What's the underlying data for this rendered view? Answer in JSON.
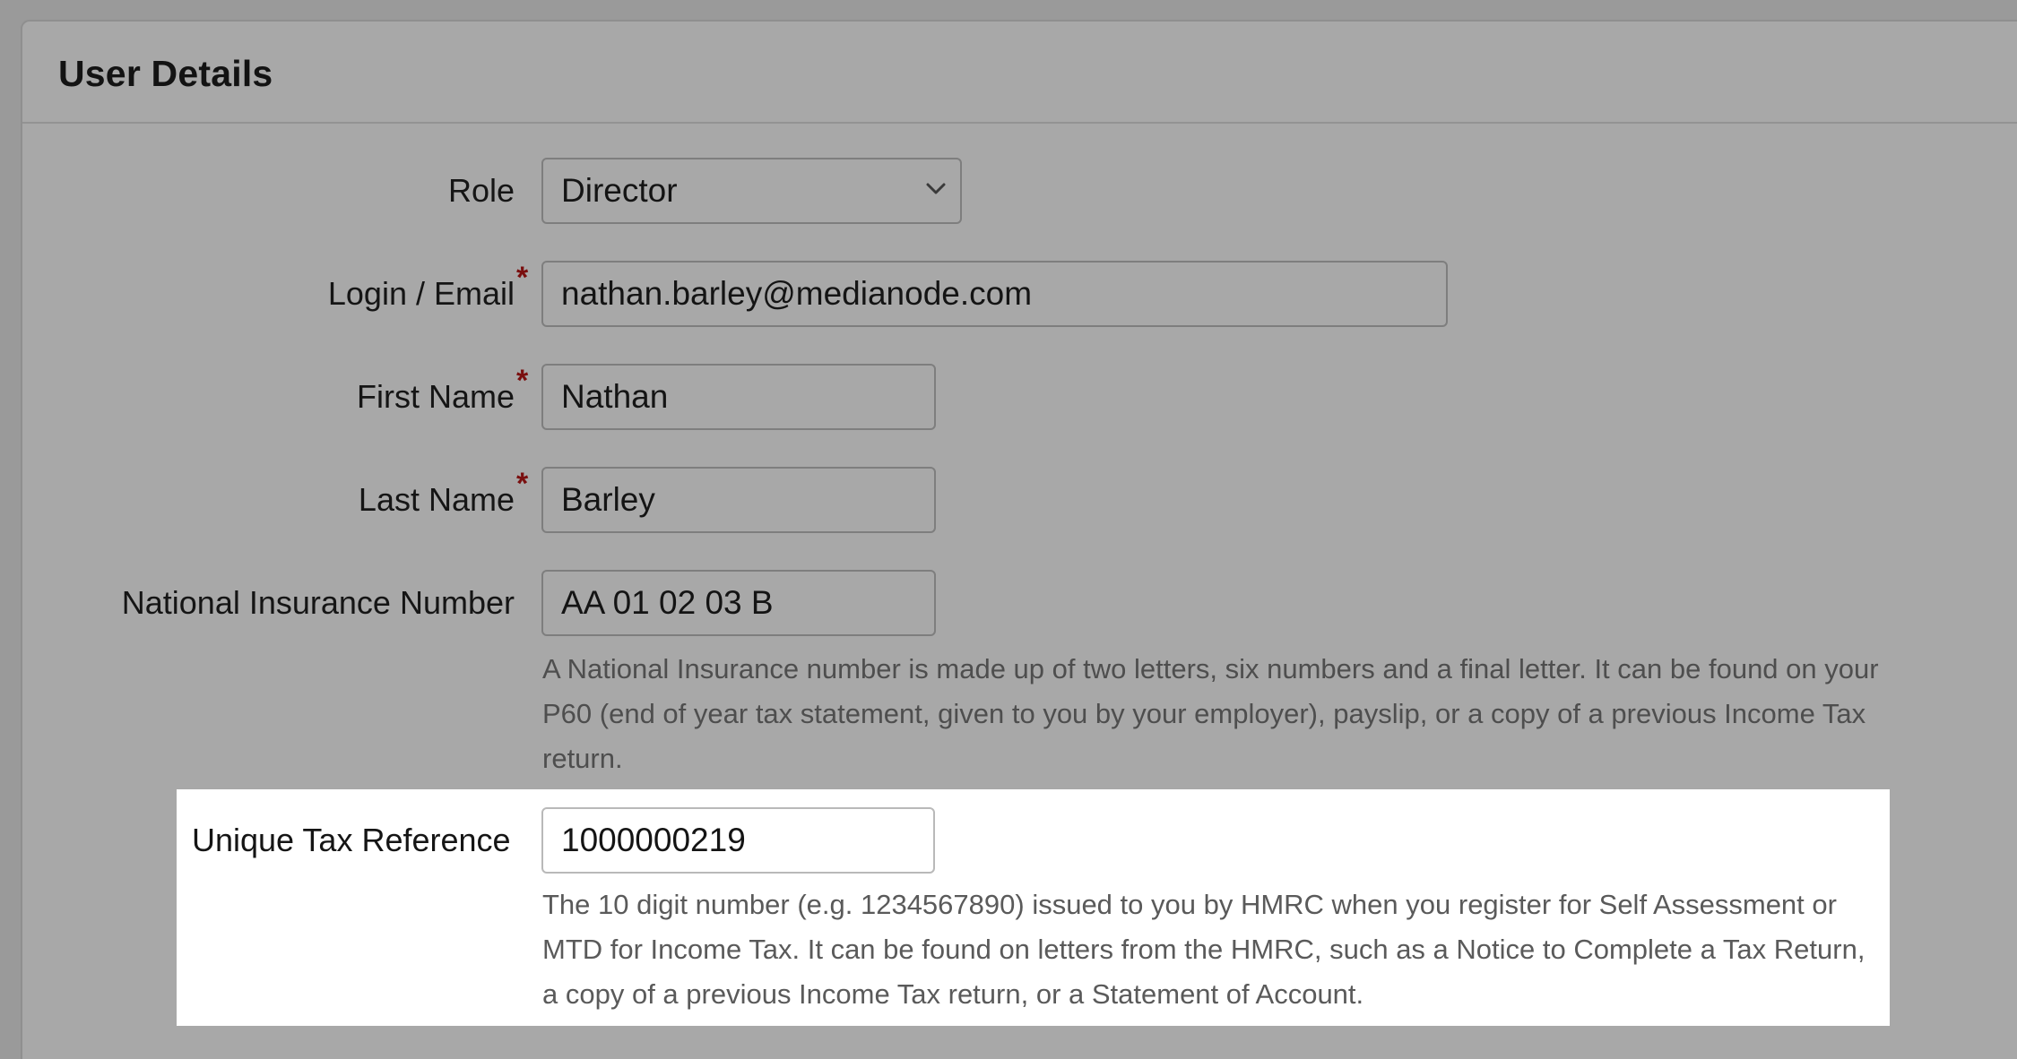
{
  "panel": {
    "title": "User Details"
  },
  "fields": {
    "role": {
      "label": "Role",
      "value": "Director"
    },
    "email": {
      "label": "Login / Email",
      "required_mark": "*",
      "value": "nathan.barley@medianode.com"
    },
    "first_name": {
      "label": "First Name",
      "required_mark": "*",
      "value": "Nathan"
    },
    "last_name": {
      "label": "Last Name",
      "required_mark": "*",
      "value": "Barley"
    },
    "ni_number": {
      "label": "National Insurance Number",
      "value": "AA 01 02 03 B",
      "help": "A National Insurance number is made up of two letters, six numbers and a final letter. It can be found on your P60 (end of year tax statement, given to you by your employer), payslip, or a copy of a previous Income Tax return."
    },
    "utr": {
      "label": "Unique Tax Reference",
      "value": "1000000219",
      "help": "The 10 digit number (e.g. 1234567890) issued to you by HMRC when you register for Self Assessment or MTD for Income Tax. It can be found on letters from the HMRC, such as a Notice to Complete a Tax Return, a copy of a previous Income Tax return, or a Statement of Account."
    }
  },
  "icons": {
    "role_select": "chevron-down-icon"
  },
  "colors": {
    "required_star": "#7a0f0f",
    "highlight_bg": "#ffffff",
    "overlay_bg": "#a8a8a8"
  }
}
